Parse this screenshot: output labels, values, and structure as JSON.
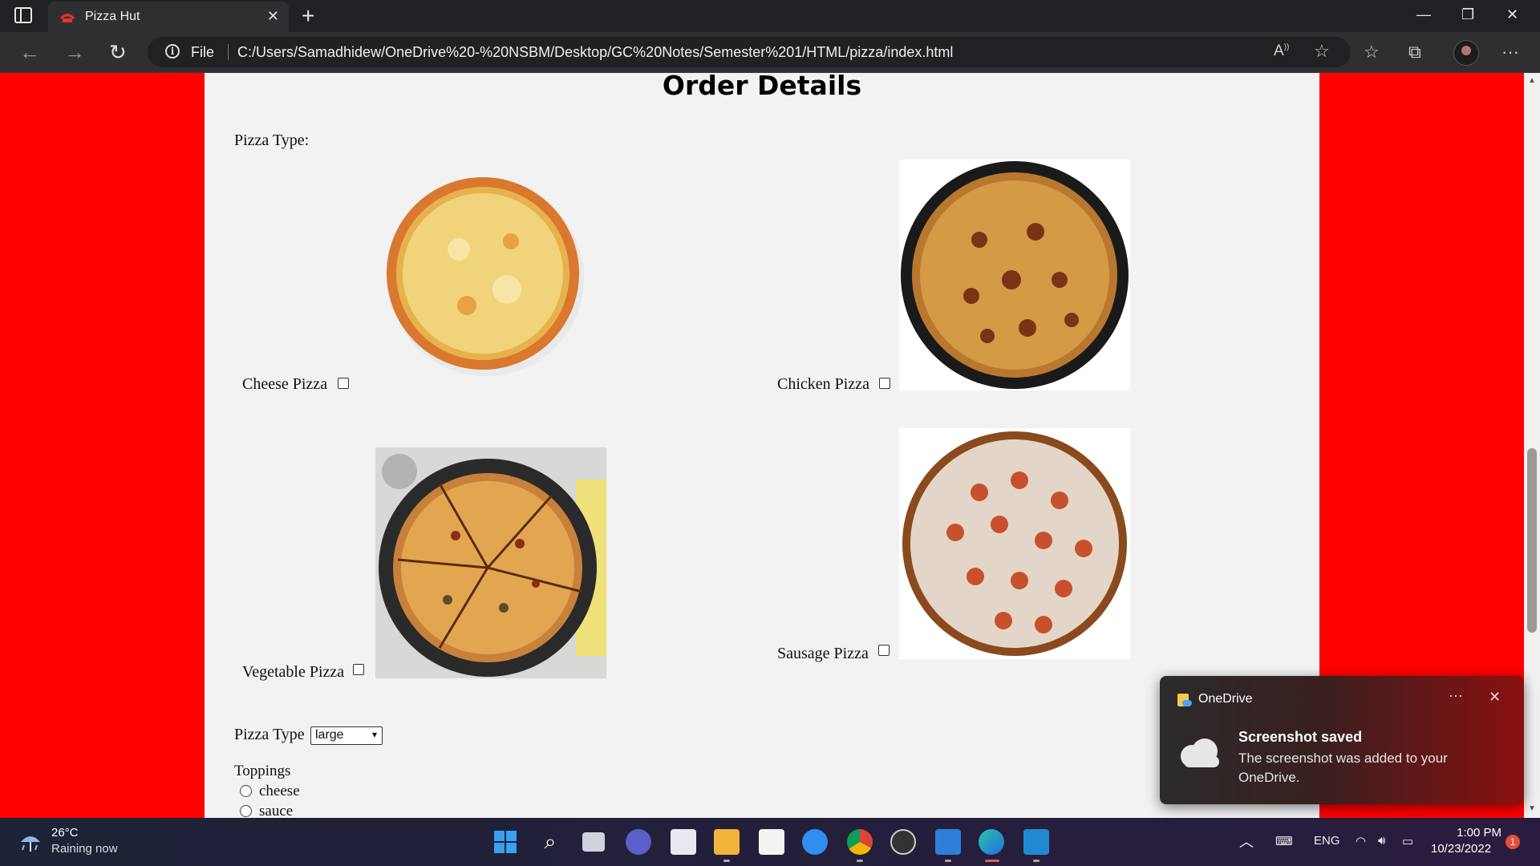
{
  "browser": {
    "tab_title": "Pizza Hut",
    "address_scheme": "File",
    "url": "C:/Users/Samadhidew/OneDrive%20-%20NSBM/Desktop/GC%20Notes/Semester%201/HTML/pizza/index.html"
  },
  "page": {
    "title": "Order Details",
    "pizza_type_label": "Pizza Type:",
    "pizzas": [
      {
        "label": "Cheese Pizza",
        "checked": false
      },
      {
        "label": "Chicken Pizza",
        "checked": false
      },
      {
        "label": "Vegetable Pizza",
        "checked": false
      },
      {
        "label": "Sausage Pizza",
        "checked": false
      }
    ],
    "size_label": "Pizza Type",
    "size_selected": "large",
    "toppings_label": "Toppings",
    "toppings": [
      "cheese",
      "sauce"
    ],
    "background_color": "#ff0000"
  },
  "toast": {
    "app": "OneDrive",
    "title": "Screenshot saved",
    "body": "The screenshot was added to your OneDrive."
  },
  "taskbar": {
    "temperature": "26°C",
    "weather": "Raining now",
    "language": "ENG",
    "time": "1:00 PM",
    "date": "10/23/2022",
    "notifications": "1"
  }
}
